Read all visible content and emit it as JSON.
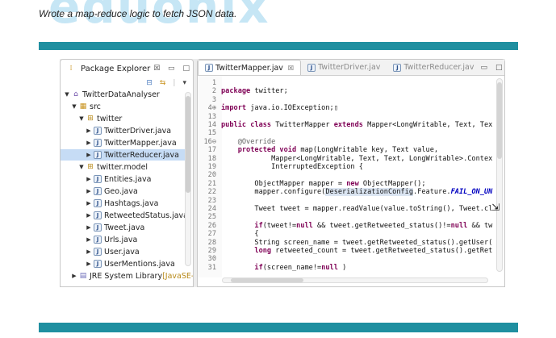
{
  "watermark": "eduonix",
  "heading": "Wrote a map-reduce logic to fetch JSON data.",
  "package_explorer": {
    "title": "Package Explorer",
    "close_glyph": "☒",
    "minimize_glyph": "▭",
    "maximize_glyph": "□",
    "tree": [
      {
        "label": "TwitterDataAnalyser",
        "icon": "project-icon",
        "arrow": "▼",
        "depth": 0
      },
      {
        "label": "src",
        "icon": "source-folder-icon",
        "arrow": "▼",
        "depth": 1
      },
      {
        "label": "twitter",
        "icon": "package-icon",
        "arrow": "▼",
        "depth": 2
      },
      {
        "label": "TwitterDriver.java",
        "icon": "java-file-icon",
        "arrow": "▶",
        "depth": 3
      },
      {
        "label": "TwitterMapper.java",
        "icon": "java-file-icon",
        "arrow": "▶",
        "depth": 3
      },
      {
        "label": "TwitterReducer.java",
        "icon": "java-file-icon",
        "arrow": "▶",
        "depth": 3,
        "selected": true
      },
      {
        "label": "twitter.model",
        "icon": "package-icon",
        "arrow": "▼",
        "depth": 2
      },
      {
        "label": "Entities.java",
        "icon": "java-file-icon",
        "arrow": "▶",
        "depth": 3
      },
      {
        "label": "Geo.java",
        "icon": "java-file-icon",
        "arrow": "▶",
        "depth": 3
      },
      {
        "label": "Hashtags.java",
        "icon": "java-file-icon",
        "arrow": "▶",
        "depth": 3
      },
      {
        "label": "RetweetedStatus.java",
        "icon": "java-file-icon",
        "arrow": "▶",
        "depth": 3
      },
      {
        "label": "Tweet.java",
        "icon": "java-file-icon",
        "arrow": "▶",
        "depth": 3
      },
      {
        "label": "Urls.java",
        "icon": "java-file-icon",
        "arrow": "▶",
        "depth": 3
      },
      {
        "label": "User.java",
        "icon": "java-file-icon",
        "arrow": "▶",
        "depth": 3
      },
      {
        "label": "UserMentions.java",
        "icon": "java-file-icon",
        "arrow": "▶",
        "depth": 3
      },
      {
        "label": "JRE System Library",
        "suffix": "[JavaSE-",
        "icon": "library-icon",
        "arrow": "▶",
        "depth": 1
      }
    ]
  },
  "editor": {
    "tabs": [
      {
        "label": "TwitterMapper.jav",
        "active": true,
        "close": "☒"
      },
      {
        "label": "TwitterDriver.jav",
        "active": false
      },
      {
        "label": "TwitterReducer.jav",
        "active": false
      }
    ],
    "lines": [
      {
        "n": "1",
        "t": [
          [
            "",
            ""
          ]
        ]
      },
      {
        "n": "2",
        "t": [
          [
            "kw",
            "package"
          ],
          [
            "",
            " twitter;"
          ]
        ]
      },
      {
        "n": "3",
        "t": [
          [
            "",
            ""
          ]
        ]
      },
      {
        "n": "4⊕",
        "t": [
          [
            "kw",
            "import"
          ],
          [
            "",
            " java.io.IOException;▯"
          ]
        ]
      },
      {
        "n": "13",
        "t": [
          [
            "",
            ""
          ]
        ]
      },
      {
        "n": "14",
        "t": [
          [
            "kw",
            "public class"
          ],
          [
            "",
            " TwitterMapper "
          ],
          [
            "kw",
            "extends"
          ],
          [
            "",
            " Mapper<LongWritable, Text, Tex"
          ]
        ]
      },
      {
        "n": "15",
        "t": [
          [
            "",
            ""
          ]
        ]
      },
      {
        "n": "16⊖",
        "t": [
          [
            "ann",
            "    @Override"
          ]
        ]
      },
      {
        "n": "17",
        "t": [
          [
            "kw",
            "    protected void"
          ],
          [
            "",
            " map(LongWritable key, Text value,"
          ]
        ]
      },
      {
        "n": "18",
        "t": [
          [
            "",
            "            Mapper<LongWritable, Text, Text, LongWritable>.Contex"
          ]
        ]
      },
      {
        "n": "19",
        "t": [
          [
            "",
            "            InterruptedException {"
          ]
        ]
      },
      {
        "n": "20",
        "t": [
          [
            "",
            ""
          ]
        ]
      },
      {
        "n": "21",
        "t": [
          [
            "",
            "        ObjectMapper mapper = "
          ],
          [
            "kw",
            "new"
          ],
          [
            "",
            " ObjectMapper();"
          ]
        ]
      },
      {
        "n": "22",
        "t": [
          [
            "",
            "        mapper.configure("
          ],
          [
            "hl",
            "DeserializationConfig"
          ],
          [
            "",
            ".Feature."
          ],
          [
            "fld",
            "FAIL_ON_UN"
          ]
        ]
      },
      {
        "n": "23",
        "t": [
          [
            "",
            ""
          ]
        ]
      },
      {
        "n": "24",
        "t": [
          [
            "",
            "        Tweet tweet = mapper.readValue(value.toString(), Tweet.cl"
          ]
        ]
      },
      {
        "n": "25",
        "t": [
          [
            "",
            ""
          ]
        ]
      },
      {
        "n": "26",
        "t": [
          [
            "kw",
            "        if"
          ],
          [
            "",
            "(tweet!="
          ],
          [
            "kw",
            "null"
          ],
          [
            "",
            " && tweet.getRetweeted_status()!="
          ],
          [
            "kw",
            "null"
          ],
          [
            "",
            " && tw"
          ]
        ]
      },
      {
        "n": "27",
        "t": [
          [
            "",
            "        {"
          ]
        ]
      },
      {
        "n": "28",
        "t": [
          [
            "",
            "        String screen_name = tweet.getRetweeted_status().getUser("
          ]
        ]
      },
      {
        "n": "29",
        "t": [
          [
            "kw",
            "        long"
          ],
          [
            "",
            " retweeted_count = tweet.getRetweeted_status().getRet"
          ]
        ]
      },
      {
        "n": "30",
        "t": [
          [
            "",
            ""
          ]
        ]
      },
      {
        "n": "31",
        "t": [
          [
            "kw",
            "        if"
          ],
          [
            "",
            "(screen_name!="
          ],
          [
            "kw",
            "null"
          ],
          [
            "",
            " )"
          ]
        ]
      }
    ]
  }
}
